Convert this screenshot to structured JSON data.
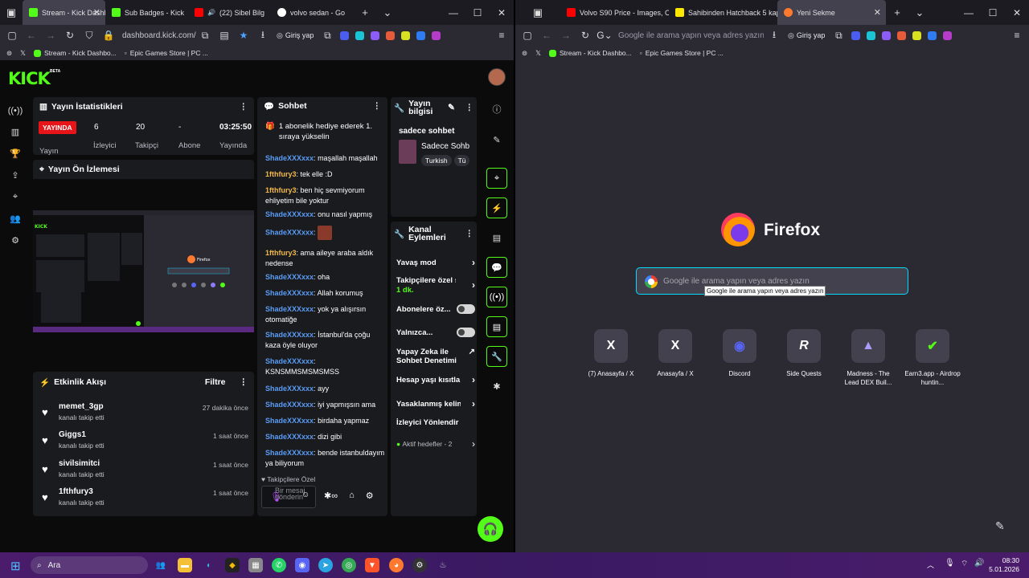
{
  "left_browser": {
    "tabs": [
      {
        "title": "Stream - Kick Dashb",
        "active": true
      },
      {
        "title": "Sub Badges - Kick"
      },
      {
        "title": "(22) Sibel Bilg"
      },
      {
        "title": "volvo sedan - Go"
      }
    ],
    "url": "dashboard.kick.com/",
    "login_label": "Giriş yap",
    "bookmarks": [
      "Stream - Kick Dashbo...",
      "Epic Games Store | PC ..."
    ]
  },
  "right_browser": {
    "tabs": [
      {
        "title": "Volvo S90 Price - Images, C"
      },
      {
        "title": "Sahibinden Hatchback 5 kap"
      },
      {
        "title": "Yeni Sekme",
        "active": true
      }
    ],
    "url_placeholder": "Google ile arama yapın veya adres yazın",
    "login_label": "Giriş yap",
    "bookmarks": [
      "Stream - Kick Dashbo...",
      "Epic Games Store | PC ..."
    ],
    "brand": "Firefox",
    "search_placeholder": "Google ile arama yapın veya adres yazın",
    "tooltip": "Google ile arama yapın veya adres yazın",
    "shortcuts": [
      {
        "label": "(7) Anasayfa / X",
        "glyph": "X"
      },
      {
        "label": "Anasayfa / X",
        "glyph": "X"
      },
      {
        "label": "Discord",
        "glyph": "◉"
      },
      {
        "label": "Side Quests",
        "glyph": "R"
      },
      {
        "label": "Madness - The Lead DEX Buil...",
        "glyph": "▲"
      },
      {
        "label": "Earn3.app - Airdrop huntin...",
        "glyph": "✔"
      }
    ]
  },
  "kick": {
    "logo": "KICK",
    "beta": "BETA",
    "stats": {
      "title": "Yayın İstatistikleri",
      "live_badge": "YAYINDA",
      "values": [
        "6",
        "20",
        "-",
        "03:25:50"
      ],
      "labels": [
        "Yayın",
        "İzleyici",
        "Takipçi",
        "Abone",
        "Yayında"
      ]
    },
    "preview": {
      "title": "Yayın Ön İzlemesi"
    },
    "feed": {
      "title": "Etkinlik Akışı",
      "filter": "Filtre",
      "items": [
        {
          "name": "memet_3gp",
          "action": "kanalı takip etti",
          "time": "27 dakika önce"
        },
        {
          "name": "Giggs1",
          "action": "kanalı takip etti",
          "time": "1 saat önce"
        },
        {
          "name": "sivilsimitci",
          "action": "kanalı takip etti",
          "time": "1 saat önce"
        },
        {
          "name": "1fthfury3",
          "action": "kanalı takip etti",
          "time": "1 saat önce"
        }
      ]
    },
    "chat": {
      "title": "Sohbet",
      "pinned": "1 abonelik hediye ederek 1. sıraya yükselin",
      "messages": [
        {
          "user": "ShadeXXXxxx",
          "text": "maşallah maşallah",
          "u": 1
        },
        {
          "user": "1fthfury3",
          "text": "tek elle :D",
          "u": 2
        },
        {
          "user": "1fthfury3",
          "text": "ben hiç sevmiyorum ehliyetim bile yoktur",
          "u": 2
        },
        {
          "user": "ShadeXXXxxx",
          "text": "onu nasıl yapmış",
          "u": 1
        },
        {
          "user": "ShadeXXXxxx",
          "text": "",
          "u": 1
        },
        {
          "user": "1fthfury3",
          "text": "ama aileye araba aldık nedense",
          "u": 2
        },
        {
          "user": "ShadeXXXxxx",
          "text": "oha",
          "u": 1
        },
        {
          "user": "ShadeXXXxxx",
          "text": "Allah korumuş",
          "u": 1
        },
        {
          "user": "ShadeXXXxxx",
          "text": "yok ya alışırsın otomatiğe",
          "u": 1
        },
        {
          "user": "ShadeXXXxxx",
          "text": "İstanbul'da çoğu kaza öyle oluyor",
          "u": 1
        },
        {
          "user": "ShadeXXXxxx",
          "text": "KSNSMMSMSMSMSS",
          "u": 1
        },
        {
          "user": "ShadeXXXxxx",
          "text": "ayy",
          "u": 1
        },
        {
          "user": "ShadeXXXxxx",
          "text": "iyi yapmışsın ama",
          "u": 1
        },
        {
          "user": "ShadeXXXxxx",
          "text": "birdaha yapmaz",
          "u": 1
        },
        {
          "user": "ShadeXXXxxx",
          "text": "dizi gibi",
          "u": 1
        },
        {
          "user": "ShadeXXXxxx",
          "text": "bende istanbuldayım ya biliyorum",
          "u": 1
        }
      ],
      "followers_only": "Takipçilere Özel",
      "input_placeholder": "Bir mesaj gönderin"
    },
    "stream_info": {
      "title": "Yayın bilgisi",
      "stream_title": "sadece sohbet",
      "category": "Sadece Sohb",
      "tags": [
        "Turkish",
        "Tü"
      ]
    },
    "channel_actions": {
      "title": "Kanal Eylemleri",
      "slow_mode": "Yavaş mod",
      "followers_only": "Takipçilere özel s",
      "followers_only_value": "1 dk.",
      "subs_only": "Abonelere öz...",
      "only": "Yalnızca...",
      "ai_moderation": "Yapay Zeka ile Sohbet Denetimi",
      "account_age": "Hesap yaşı kısıtla",
      "banned_words": "Yasaklanmış kelin",
      "viewer_redirect": "İzleyici Yönlendir",
      "active_goals": "Aktif hedefler - 2"
    }
  },
  "taskbar": {
    "search": "Ara",
    "time": "08:30",
    "date": "5.01.2026"
  }
}
